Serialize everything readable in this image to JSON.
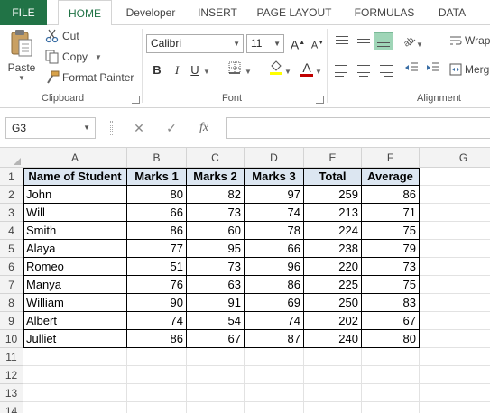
{
  "tabs": [
    "FILE",
    "HOME",
    "Developer",
    "INSERT",
    "PAGE LAYOUT",
    "FORMULAS",
    "DATA"
  ],
  "clipboard": {
    "paste": "Paste",
    "cut": "Cut",
    "copy": "Copy",
    "format_painter": "Format Painter",
    "label": "Clipboard"
  },
  "font": {
    "name": "Calibri",
    "size": "11",
    "label": "Font",
    "bold": "B",
    "italic": "I",
    "underline": "U",
    "grow": "A",
    "shrink": "A",
    "color_letter": "A"
  },
  "alignment": {
    "wrap": "Wrap",
    "merge": "Merg",
    "label": "Alignment"
  },
  "formula_bar": {
    "name_box": "G3",
    "fx": "fx",
    "cancel": "✕",
    "enter": "✓"
  },
  "colors": {
    "accent": "#217346",
    "header_fill": "#dce6f1",
    "selected_align": "#9fd5b7",
    "font_color_bar": "#c00000",
    "highlight_bar": "#ffff00"
  },
  "sheet": {
    "columns": [
      "A",
      "B",
      "C",
      "D",
      "E",
      "F",
      "G"
    ],
    "rows": [
      "1",
      "2",
      "3",
      "4",
      "5",
      "6",
      "7",
      "8",
      "9",
      "10",
      "11",
      "12",
      "13",
      "14"
    ],
    "header": [
      "Name of Student",
      "Marks 1",
      "Marks 2",
      "Marks 3",
      "Total",
      "Average"
    ],
    "data": [
      [
        "John",
        "80",
        "82",
        "97",
        "259",
        "86"
      ],
      [
        "Will",
        "66",
        "73",
        "74",
        "213",
        "71"
      ],
      [
        "Smith",
        "86",
        "60",
        "78",
        "224",
        "75"
      ],
      [
        "Alaya",
        "77",
        "95",
        "66",
        "238",
        "79"
      ],
      [
        "Romeo",
        "51",
        "73",
        "96",
        "220",
        "73"
      ],
      [
        "Manya",
        "76",
        "63",
        "86",
        "225",
        "75"
      ],
      [
        "William",
        "90",
        "91",
        "69",
        "250",
        "83"
      ],
      [
        "Albert",
        "74",
        "54",
        "74",
        "202",
        "67"
      ],
      [
        "Julliet",
        "86",
        "67",
        "87",
        "240",
        "80"
      ]
    ]
  }
}
